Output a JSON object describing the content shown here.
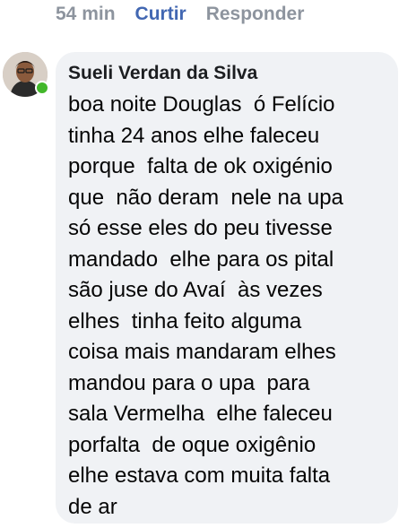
{
  "actions": {
    "timestamp": "54 min",
    "like_label": "Curtir",
    "reply_label": "Responder"
  },
  "comment": {
    "author": "Sueli Verdan da Silva",
    "lines": [
      "boa noite Douglas  ó Felício",
      "tinha 24 anos elhe faleceu",
      "porque  falta de ok oxigénio",
      "que  não deram  nele na upa",
      "só esse eles do peu tivesse",
      "mandado  elhe para os pital",
      "são juse do Avaí  às vezes",
      "elhes  tinha feito alguma",
      "coisa mais mandaram elhes",
      "mandou para o upa  para",
      "sala Vermelha  elhe faleceu",
      "porfalta  de oque oxigênio",
      "elhe estava com muita falta",
      "de ar"
    ]
  },
  "colors": {
    "like": "#4267b2",
    "muted": "#8d949e",
    "bubble": "#f0f2f5",
    "online": "#42b72a"
  }
}
